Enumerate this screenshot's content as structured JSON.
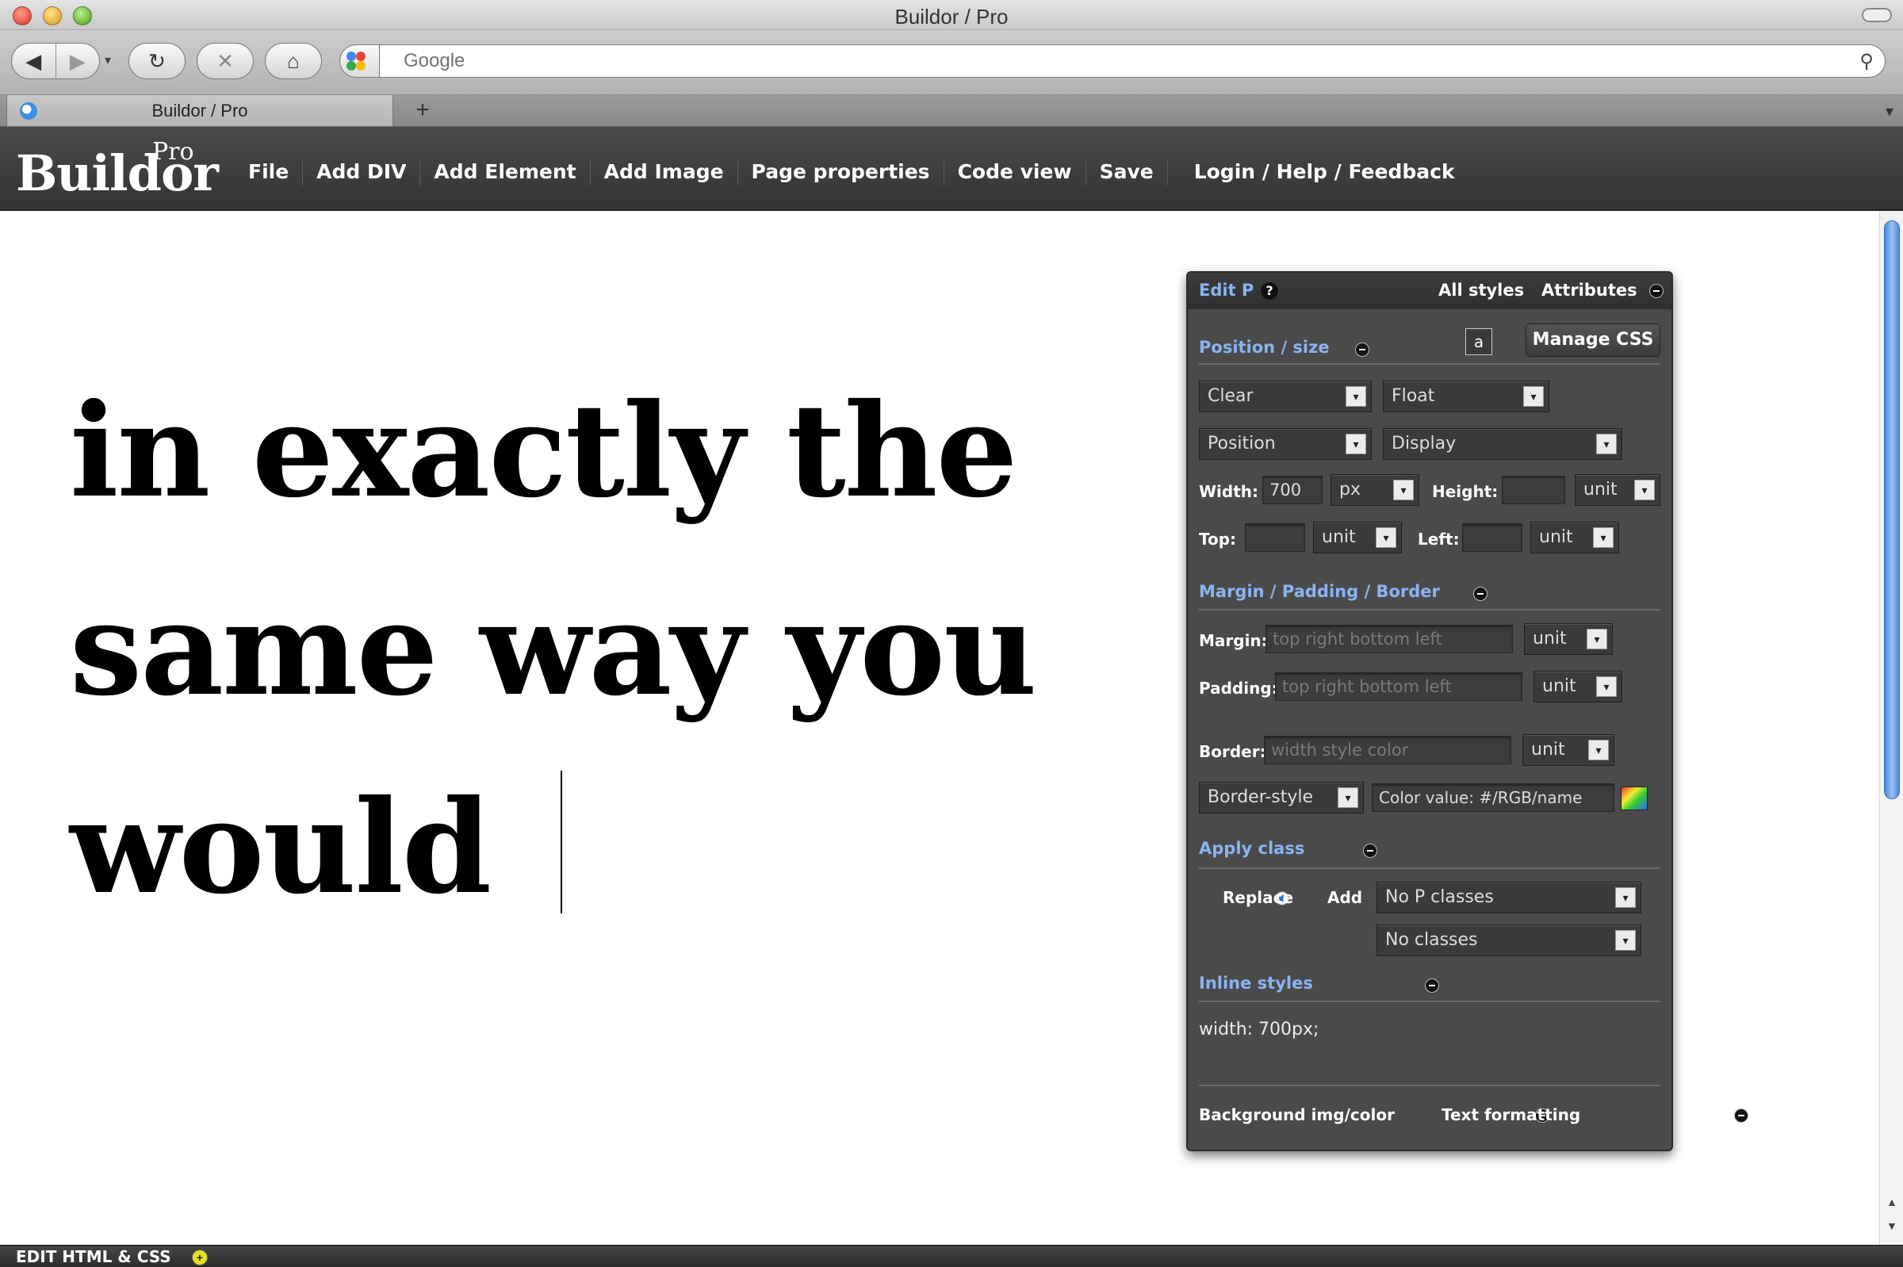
{
  "window": {
    "title": "Buildor / Pro"
  },
  "browser": {
    "search_placeholder": "Google",
    "tab_title": "Buildor / Pro",
    "new_tab_symbol": "+",
    "back_symbol": "◀",
    "forward_symbol": "▶",
    "reload_symbol": "↻",
    "stop_symbol": "✕",
    "home_symbol": "⌂",
    "search_symbol": "⚲",
    "tab_menu_symbol": "▾"
  },
  "app": {
    "logo": "Buildor",
    "logo_badge": "Pro",
    "menu": [
      "File",
      "Add DIV",
      "Add Element",
      "Add Image",
      "Page properties",
      "Code view",
      "Save"
    ],
    "menu_login": "Login / Help / Feedback"
  },
  "canvas": {
    "lines": [
      "in exactly the",
      "same way you",
      "would"
    ]
  },
  "panel": {
    "title": "Edit P",
    "help": "?",
    "tabs": [
      "All styles",
      "Attributes"
    ],
    "position_section": "Position / size",
    "a_button": "a",
    "manage_css": "Manage CSS",
    "clear": "Clear",
    "float": "Float",
    "position": "Position",
    "display": "Display",
    "width_label": "Width:",
    "width_value": "700",
    "width_unit": "px",
    "height_label": "Height:",
    "height_unit": "unit",
    "top_label": "Top:",
    "top_unit": "unit",
    "left_label": "Left:",
    "left_unit": "unit",
    "margin_section": "Margin / Padding / Border",
    "margin_label": "Margin:",
    "margin_placeholder": "top right bottom left",
    "margin_unit": "unit",
    "padding_label": "Padding:",
    "padding_placeholder": "top right bottom left",
    "padding_unit": "unit",
    "border_label": "Border:",
    "border_placeholder": "width style color",
    "border_unit": "unit",
    "border_style": "Border-style",
    "color_value": "Color value: #/RGB/name",
    "apply_class_section": "Apply class",
    "replace_label": "Replace",
    "add_label": "Add",
    "p_classes": "No P classes",
    "classes": "No classes",
    "inline_section": "Inline styles",
    "inline_value": "width: 700px;",
    "bg_section": "Background img/color",
    "text_section": "Text formatting"
  },
  "bottom": {
    "label": "EDIT HTML & CSS",
    "toggle": "+"
  },
  "colors": {
    "appbar": "#3a3a3a",
    "panel": "#4a4a4a",
    "link_blue": "#8ab4f2",
    "scroll_thumb": "#6a9be2"
  }
}
